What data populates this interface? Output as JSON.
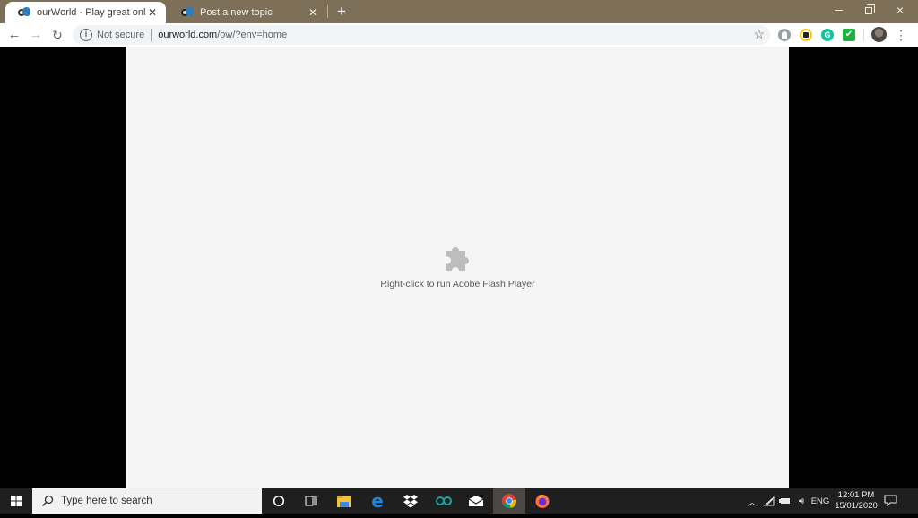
{
  "browser": {
    "tabs": [
      {
        "title": "ourWorld - Play great online puzz",
        "active": true
      },
      {
        "title": "Post a new topic",
        "active": false
      }
    ],
    "new_tab_label": "+",
    "window_controls": {
      "minimize": "minimize",
      "restore": "restore",
      "close": "×"
    },
    "address_bar": {
      "security_label": "Not secure",
      "url_host": "ourworld.com",
      "url_path": "/ow/?env=home"
    },
    "extensions": [
      "ghostery-extension",
      "honey-extension",
      "grammarly-extension",
      "checkmark-extension"
    ],
    "colors": {
      "frame": "#7e6f58",
      "toolbar": "#ffffff",
      "omnibox": "#f1f3f4"
    }
  },
  "page": {
    "plugin_placeholder": {
      "icon": "puzzle-piece-icon",
      "message": "Right-click to run Adobe Flash Player"
    },
    "colors": {
      "background": "#f5f5f5",
      "letterbox": "#000000"
    }
  },
  "taskbar": {
    "search_placeholder": "Type here to search",
    "pinned_apps": [
      "cortana",
      "task-view",
      "file-explorer",
      "edge",
      "dropbox",
      "arduino",
      "mail",
      "chrome",
      "firefox"
    ],
    "active_app": "chrome",
    "tray": {
      "language": "ENG",
      "time": "12:01 PM",
      "date": "15/01/2020"
    }
  }
}
